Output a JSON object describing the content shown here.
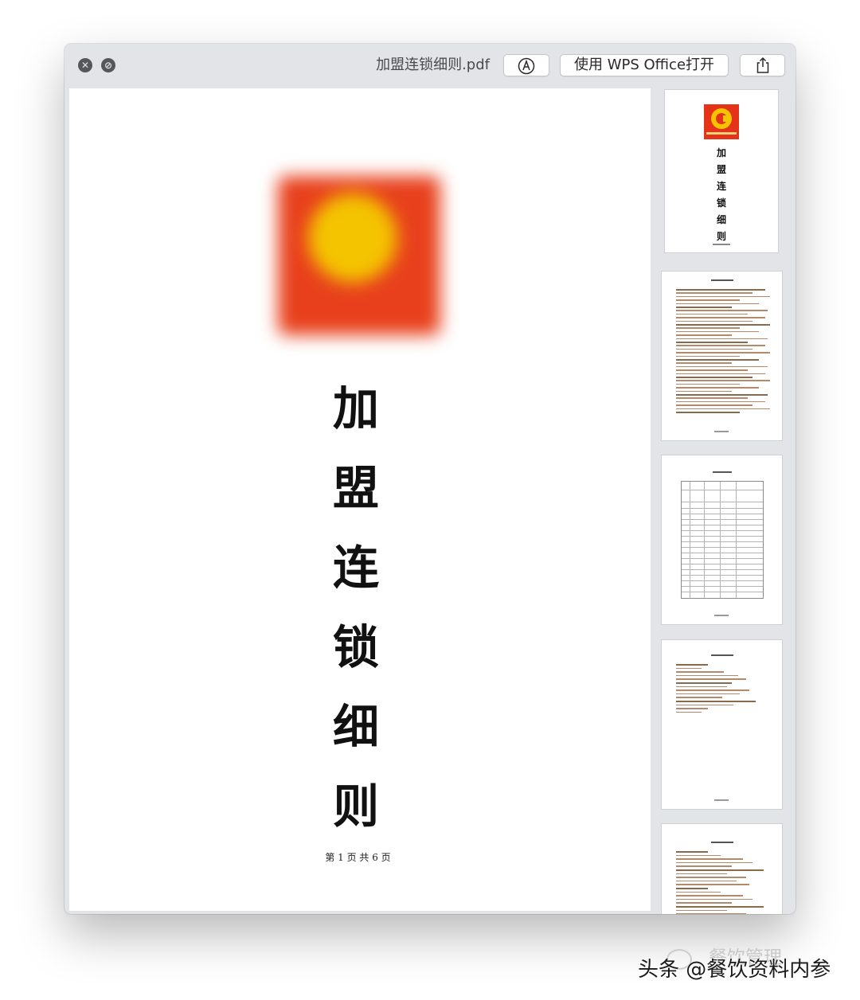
{
  "window": {
    "title": "加盟连锁细则.pdf",
    "open_with_label": "使用 WPS Office打开"
  },
  "toolbar_icons": {
    "close": "close-icon",
    "minimize": "minimize-icon",
    "markup": "markup-pen-icon",
    "share": "share-icon"
  },
  "main_page": {
    "logo": "company-logo-blurred",
    "title_chars": [
      "加",
      "盟",
      "连",
      "锁",
      "细",
      "则"
    ],
    "page_number": "第 1 页 共 6 页"
  },
  "thumbnails": [
    {
      "page": 1,
      "title_chars": [
        "加",
        "盟",
        "连",
        "锁",
        "细",
        "则"
      ],
      "logo": "company-logo"
    },
    {
      "page": 2
    },
    {
      "page": 3
    },
    {
      "page": 4
    },
    {
      "page": 5
    }
  ],
  "watermark": {
    "faded": "餐饮管理",
    "main": "头条 @餐饮资料内参"
  },
  "colors": {
    "logo_red": "#e5331a",
    "logo_yellow": "#f4c400",
    "window_chrome": "#e3e4e7"
  }
}
